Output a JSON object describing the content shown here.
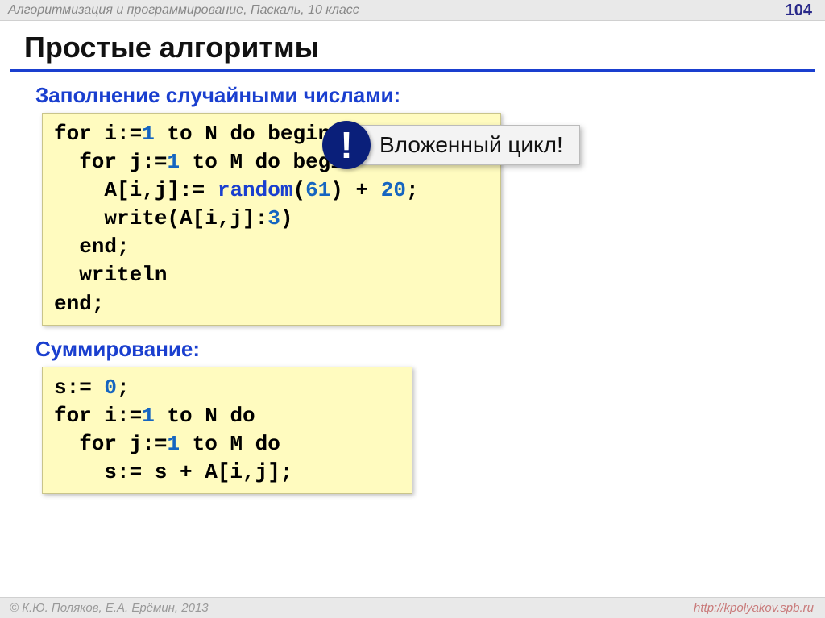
{
  "header": {
    "text": "Алгоритмизация и программирование, Паскаль, 10 класс",
    "page": "104"
  },
  "title": "Простые алгоритмы",
  "section1": {
    "label": "Заполнение случайными числами:",
    "code": {
      "l1a": "for i:=",
      "l1n": "1",
      "l1b": " to N do begin",
      "l2a": "  for j:=",
      "l2n": "1",
      "l2b": " to M do begin",
      "l3a": "    A[i,j]:= ",
      "l3fn": "random",
      "l3b": "(",
      "l3n1": "61",
      "l3c": ") + ",
      "l3n2": "20",
      "l3d": ";",
      "l4a": "    write(A[i,j]:",
      "l4n": "3",
      "l4b": ")",
      "l5": "  end;",
      "l6": "  writeln",
      "l7": "end;"
    }
  },
  "callout": {
    "bang": "!",
    "text": "Вложенный цикл!"
  },
  "section2": {
    "label": "Суммирование:",
    "code": {
      "l1a": "s:= ",
      "l1n": "0",
      "l1b": ";",
      "l2a": "for i:=",
      "l2n": "1",
      "l2b": " to N do",
      "l3a": "  for j:=",
      "l3n": "1",
      "l3b": " to M do",
      "l4": "    s:= s + A[i,j];"
    }
  },
  "footer": {
    "left": "© К.Ю. Поляков, Е.А. Ерёмин, 2013",
    "right": "http://kpolyakov.spb.ru"
  }
}
